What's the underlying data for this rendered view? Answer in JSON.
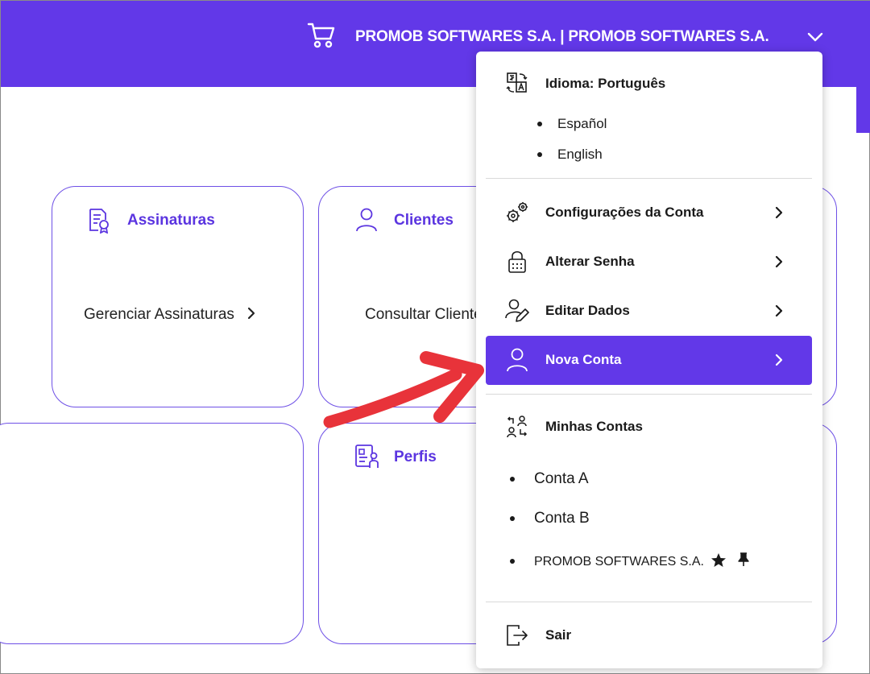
{
  "header": {
    "account_label": "PROMOB SOFTWARES S.A. | PROMOB SOFTWARES S.A.",
    "cart_icon": "cart-icon",
    "chevron_icon": "chevron-down-icon",
    "brand_color": "#6238e8"
  },
  "cards": [
    {
      "title": "Assinaturas",
      "icon": "document-certificate-icon",
      "link": "Gerenciar Assinaturas"
    },
    {
      "title": "Clientes",
      "icon": "user-icon",
      "link": "Consultar Clientes"
    },
    {
      "title": "Perfis",
      "icon": "profile-card-icon"
    }
  ],
  "menu": {
    "language": {
      "label": "Idioma: Português",
      "icon": "translate-icon",
      "options": [
        "Español",
        "English"
      ]
    },
    "items": [
      {
        "label": "Configurações da Conta",
        "icon": "gears-icon"
      },
      {
        "label": "Alterar Senha",
        "icon": "lock-icon"
      },
      {
        "label": "Editar Dados",
        "icon": "user-edit-icon"
      },
      {
        "label": "Nova Conta",
        "icon": "user-icon",
        "active": true
      }
    ],
    "accounts": {
      "label": "Minhas Contas",
      "icon": "switch-users-icon",
      "list": [
        "Conta A",
        "Conta B",
        "PROMOB SOFTWARES S.A."
      ],
      "favorite_icon": "star-icon",
      "pin_icon": "pin-icon"
    },
    "logout": {
      "label": "Sair",
      "icon": "logout-icon"
    }
  },
  "annotation": {
    "icon": "red-arrow-icon",
    "color": "#e8333a"
  }
}
